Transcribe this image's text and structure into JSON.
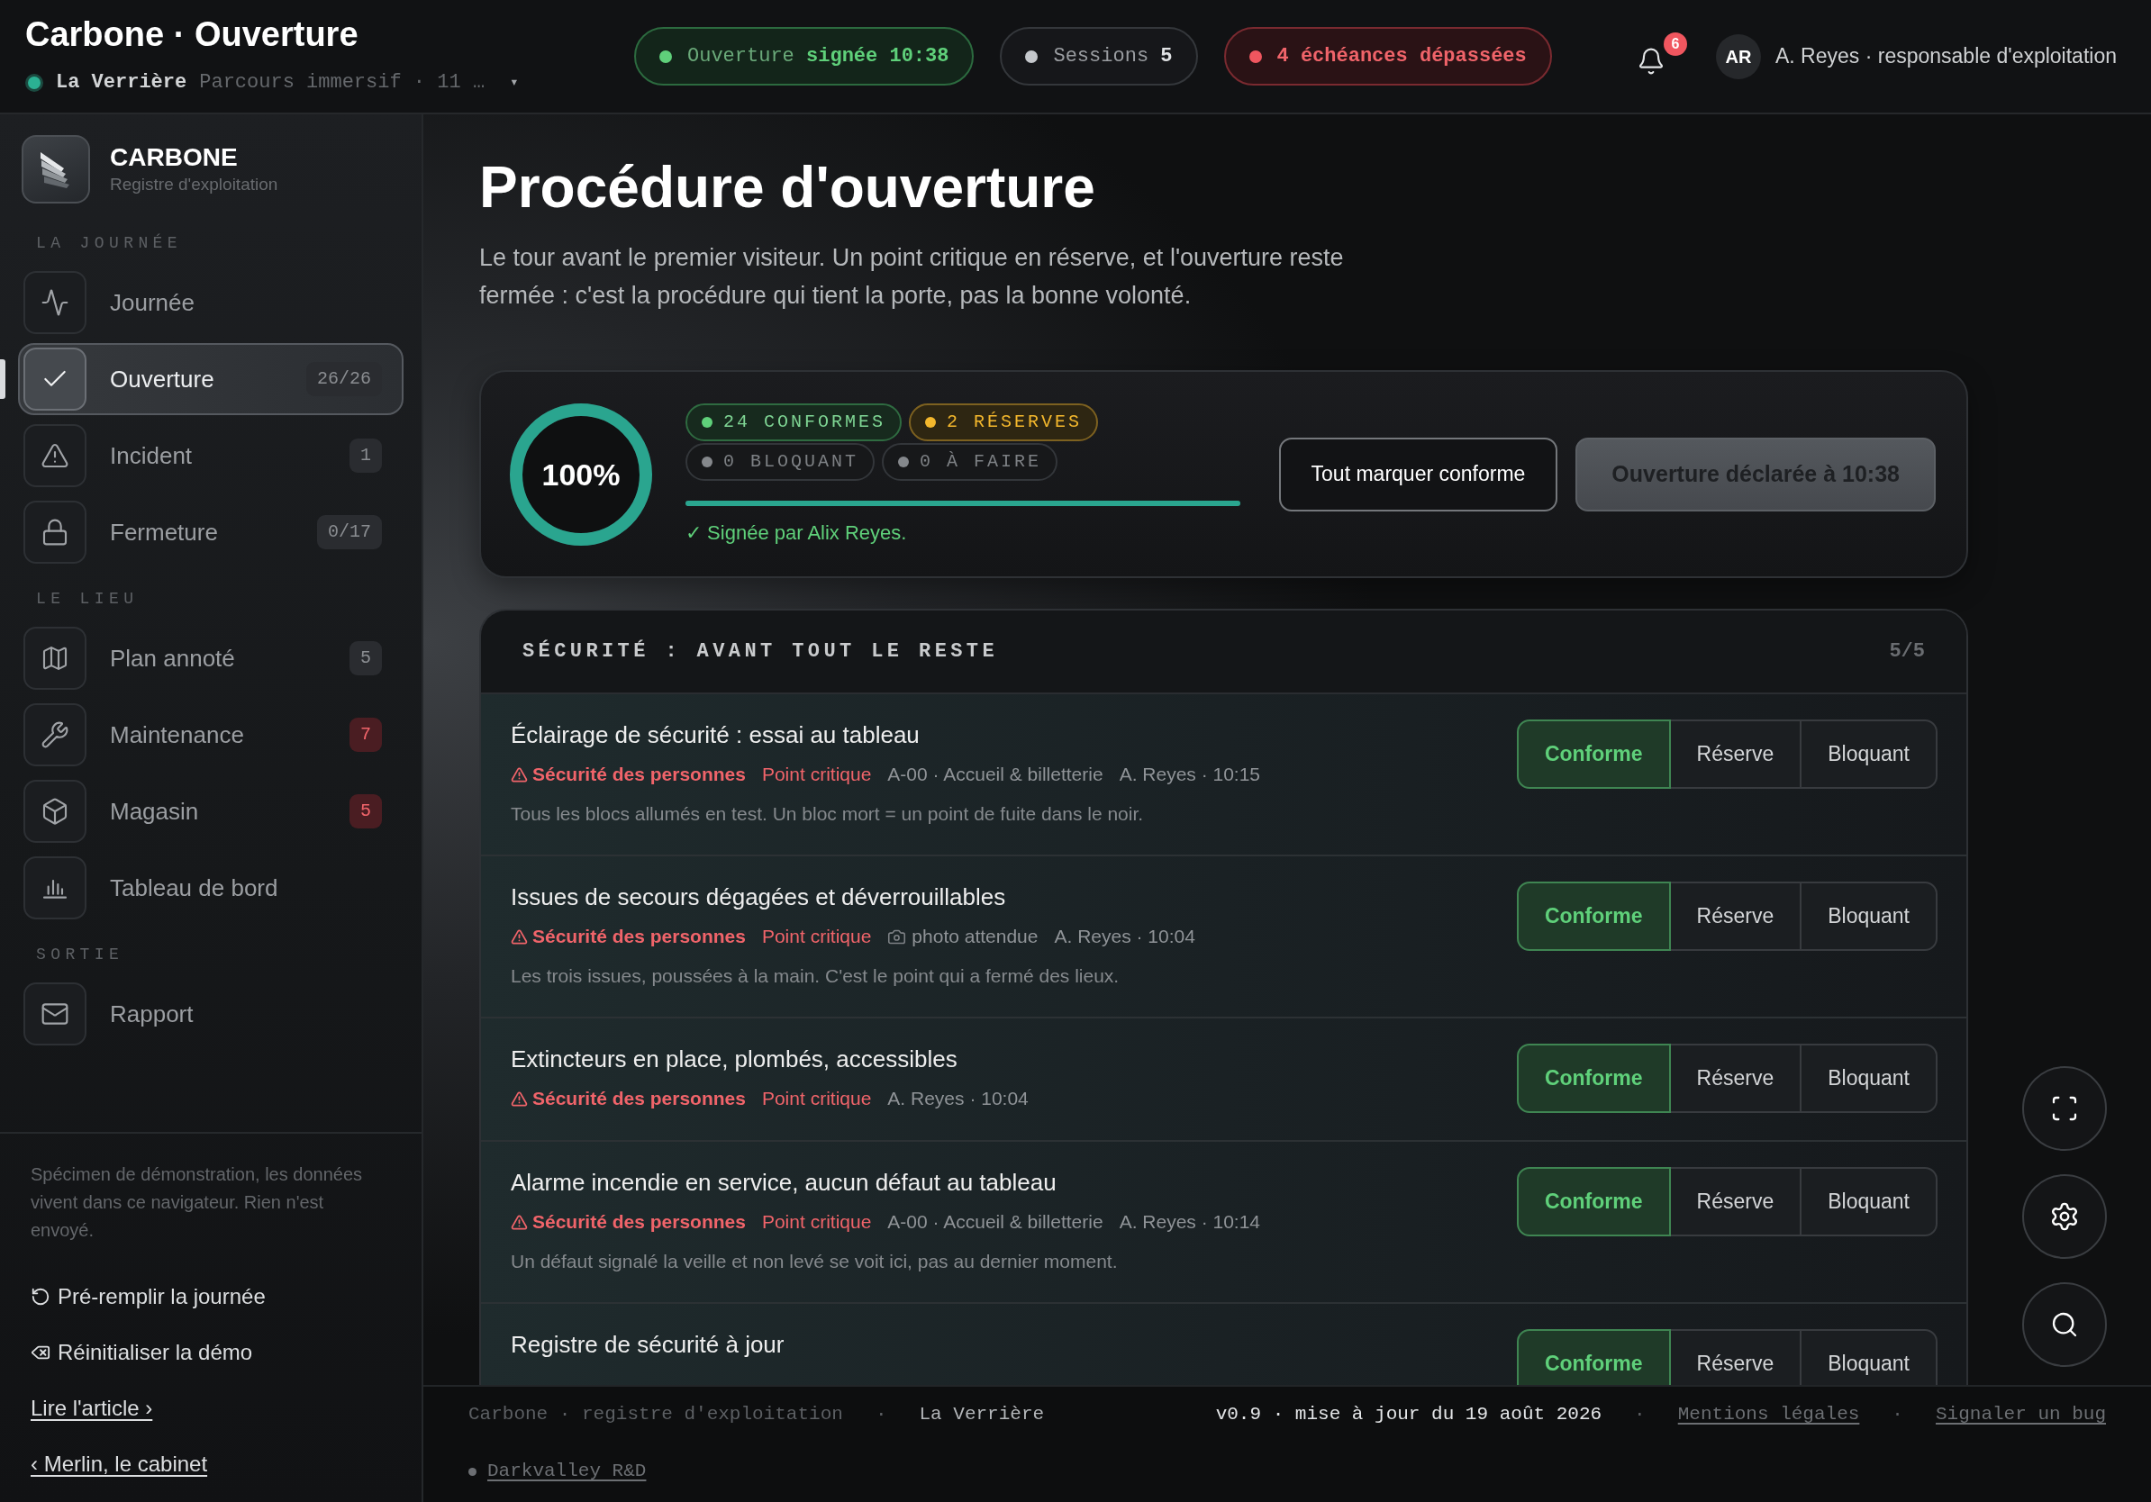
{
  "topbar": {
    "title": "Carbone · Ouverture",
    "venue": {
      "name": "La Verrière",
      "detail": "Parcours immersif · 11 …",
      "caret": "▾"
    },
    "pills": [
      {
        "kind": "success",
        "label": "Ouverture",
        "value": "signée 10:38"
      },
      {
        "kind": "neutral",
        "label": "Sessions",
        "value": "5"
      },
      {
        "kind": "danger",
        "value": "4 échéances dépassées"
      }
    ],
    "notifications": {
      "count": "6"
    },
    "user": {
      "initials": "AR",
      "name": "A. Reyes · responsable d'exploitation"
    }
  },
  "sidebar": {
    "brand": {
      "name": "CARBONE",
      "subtitle": "Registre d'exploitation"
    },
    "sections": [
      {
        "heading": "LA JOURNÉE",
        "items": [
          {
            "label": "Journée",
            "selected": false
          },
          {
            "label": "Ouverture",
            "selected": true,
            "badge": "26/26",
            "alert": false
          },
          {
            "label": "Incident",
            "selected": false,
            "badge": "1",
            "alert": false
          },
          {
            "label": "Fermeture",
            "selected": false,
            "badge": "0/17",
            "alert": false
          }
        ]
      },
      {
        "heading": "LE LIEU",
        "items": [
          {
            "label": "Plan annoté",
            "selected": false,
            "badge": "5",
            "alert": false
          },
          {
            "label": "Maintenance",
            "selected": false,
            "badge": "7",
            "alert": true
          },
          {
            "label": "Magasin",
            "selected": false,
            "badge": "5",
            "alert": true
          },
          {
            "label": "Tableau de bord",
            "selected": false
          }
        ]
      },
      {
        "heading": "SORTIE",
        "items": [
          {
            "label": "Rapport",
            "selected": false
          }
        ]
      }
    ],
    "note": "Spécimen de démonstration, les données vivent dans ce navigateur. Rien n'est envoyé.",
    "actions": [
      {
        "kind": "action",
        "label": "Pré-remplir la journée"
      },
      {
        "kind": "action",
        "label": "Réinitialiser la démo"
      },
      {
        "kind": "link",
        "label": "Lire l'article ›"
      },
      {
        "kind": "link",
        "label": "‹ Merlin, le cabinet"
      }
    ]
  },
  "page": {
    "title": "Procédure d'ouverture",
    "description": "Le tour avant le premier visiteur. Un point critique en réserve, et l'ouverture reste fermée : c'est la procédure qui tient la porte, pas la bonne volonté."
  },
  "summary": {
    "ring": {
      "level": 1,
      "reading": "100%"
    },
    "counts": [
      {
        "kind": "success",
        "text": "24 CONFORMES"
      },
      {
        "kind": "warning",
        "text": "2 RÉSERVES"
      },
      {
        "kind": "neutral",
        "text": "0 BLOQUANT"
      },
      {
        "kind": "neutral",
        "text": "0 À FAIRE"
      }
    ],
    "bar": {
      "level": 1
    },
    "signature": "✓ Signée par Alix Reyes.",
    "buttons": [
      {
        "kind": "secondary",
        "label": "Tout marquer conforme",
        "disabled": false
      },
      {
        "kind": "primary",
        "label": "Ouverture déclarée à 10:38",
        "disabled": true
      }
    ]
  },
  "section": {
    "title": "SÉCURITÉ : AVANT TOUT LE RESTE",
    "count": "5/5",
    "items": [
      {
        "title": "Éclairage de sécurité : essai au tableau",
        "meta": [
          {
            "kind": "category",
            "text": "Sécurité des personnes"
          },
          {
            "kind": "critical",
            "text": "Point critique"
          },
          {
            "kind": "location",
            "text": "A-00 · Accueil & billetterie"
          },
          {
            "kind": "author",
            "text": "A. Reyes · 10:15"
          }
        ],
        "note": "Tous les blocs allumés en test. Un bloc mort = un point de fuite dans le noir.",
        "options": [
          {
            "label": "Conforme",
            "selected": true
          },
          {
            "label": "Réserve",
            "selected": false
          },
          {
            "label": "Bloquant",
            "selected": false
          }
        ]
      },
      {
        "title": "Issues de secours dégagées et déverrouillables",
        "meta": [
          {
            "kind": "category",
            "text": "Sécurité des personnes"
          },
          {
            "kind": "critical",
            "text": "Point critique"
          },
          {
            "kind": "photo",
            "text": "photo attendue"
          },
          {
            "kind": "author",
            "text": "A. Reyes · 10:04"
          }
        ],
        "note": "Les trois issues, poussées à la main. C'est le point qui a fermé des lieux.",
        "options": [
          {
            "label": "Conforme",
            "selected": true
          },
          {
            "label": "Réserve",
            "selected": false
          },
          {
            "label": "Bloquant",
            "selected": false
          }
        ]
      },
      {
        "title": "Extincteurs en place, plombés, accessibles",
        "meta": [
          {
            "kind": "category",
            "text": "Sécurité des personnes"
          },
          {
            "kind": "critical",
            "text": "Point critique"
          },
          {
            "kind": "author",
            "text": "A. Reyes · 10:04"
          }
        ],
        "options": [
          {
            "label": "Conforme",
            "selected": true
          },
          {
            "label": "Réserve",
            "selected": false
          },
          {
            "label": "Bloquant",
            "selected": false
          }
        ]
      },
      {
        "title": "Alarme incendie en service, aucun défaut au tableau",
        "meta": [
          {
            "kind": "category",
            "text": "Sécurité des personnes"
          },
          {
            "kind": "critical",
            "text": "Point critique"
          },
          {
            "kind": "location",
            "text": "A-00 · Accueil & billetterie"
          },
          {
            "kind": "author",
            "text": "A. Reyes · 10:14"
          }
        ],
        "note": "Un défaut signalé la veille et non levé se voit ici, pas au dernier moment.",
        "options": [
          {
            "label": "Conforme",
            "selected": true
          },
          {
            "label": "Réserve",
            "selected": false
          },
          {
            "label": "Bloquant",
            "selected": false
          }
        ]
      },
      {
        "title": "Registre de sécurité à jour",
        "options": [
          {
            "label": "Conforme",
            "selected": true
          },
          {
            "label": "Réserve",
            "selected": false
          },
          {
            "label": "Bloquant",
            "selected": false
          }
        ]
      }
    ]
  },
  "footer": {
    "left": [
      {
        "kind": "muted",
        "text": "Carbone · registre d'exploitation"
      },
      {
        "kind": "separator",
        "text": "·"
      },
      {
        "kind": "strong",
        "text": "La Verrière"
      }
    ],
    "right": [
      {
        "kind": "version",
        "text": "v0.9 · mise à jour du 19 août 2026"
      },
      {
        "kind": "separator",
        "text": "·"
      },
      {
        "kind": "link",
        "text": "Mentions légales"
      },
      {
        "kind": "separator",
        "text": "·"
      },
      {
        "kind": "link",
        "text": "Signaler un bug"
      }
    ],
    "credit": {
      "text": "Darkvalley R&D"
    }
  }
}
